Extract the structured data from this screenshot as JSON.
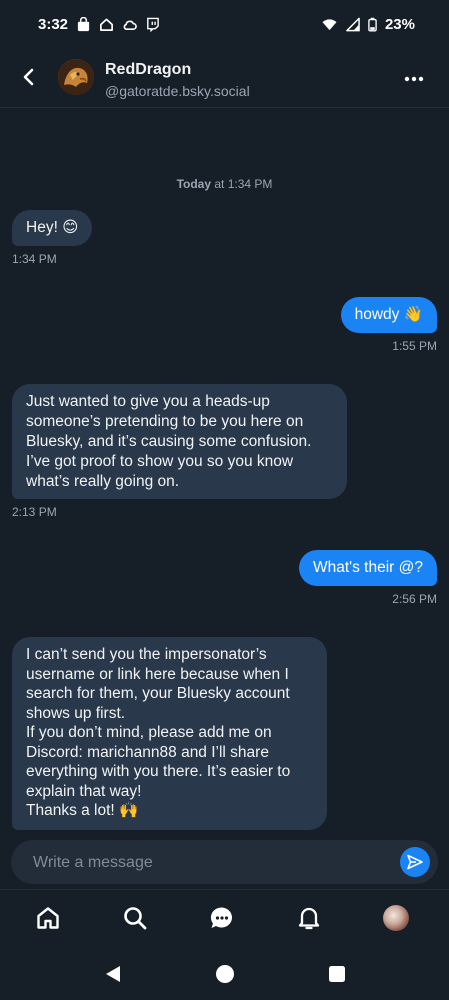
{
  "status_bar": {
    "time": "3:32",
    "battery": "23%"
  },
  "header": {
    "name": "RedDragon",
    "handle": "@gatoratde.bsky.social"
  },
  "conversation": {
    "day_label_bold": "Today",
    "day_label_rest": " at 1:34 PM",
    "messages": [
      {
        "direction": "in",
        "text": "Hey! 😊",
        "time": "1:34 PM"
      },
      {
        "direction": "out",
        "text": "howdy 👋",
        "time": "1:55 PM"
      },
      {
        "direction": "in",
        "text": "Just wanted to give you a heads-up someone’s pretending to be you here on Bluesky, and it’s causing some confusion. I’ve got proof to show you so you know what’s really going on.",
        "time": "2:13 PM"
      },
      {
        "direction": "out",
        "text": "What's their @?",
        "time": "2:56 PM"
      },
      {
        "direction": "in",
        "text": "I can’t send you the impersonator’s username or link here because when I search for them, your Bluesky account shows up first.\nIf you don’t mind, please add me on Discord: marichann88 and I’ll share everything with you there. It’s easier to explain that way!\nThanks a lot! 🙌",
        "time": ""
      }
    ]
  },
  "composer": {
    "placeholder": "Write a message"
  },
  "bottom_nav": [
    "home-icon",
    "search-icon",
    "chat-icon",
    "bell-icon",
    "profile-avatar"
  ],
  "colors": {
    "background": "#161e27",
    "incoming_bubble": "#29384a",
    "outgoing_bubble": "#1b84f4",
    "muted_text": "#9aa6b3"
  }
}
